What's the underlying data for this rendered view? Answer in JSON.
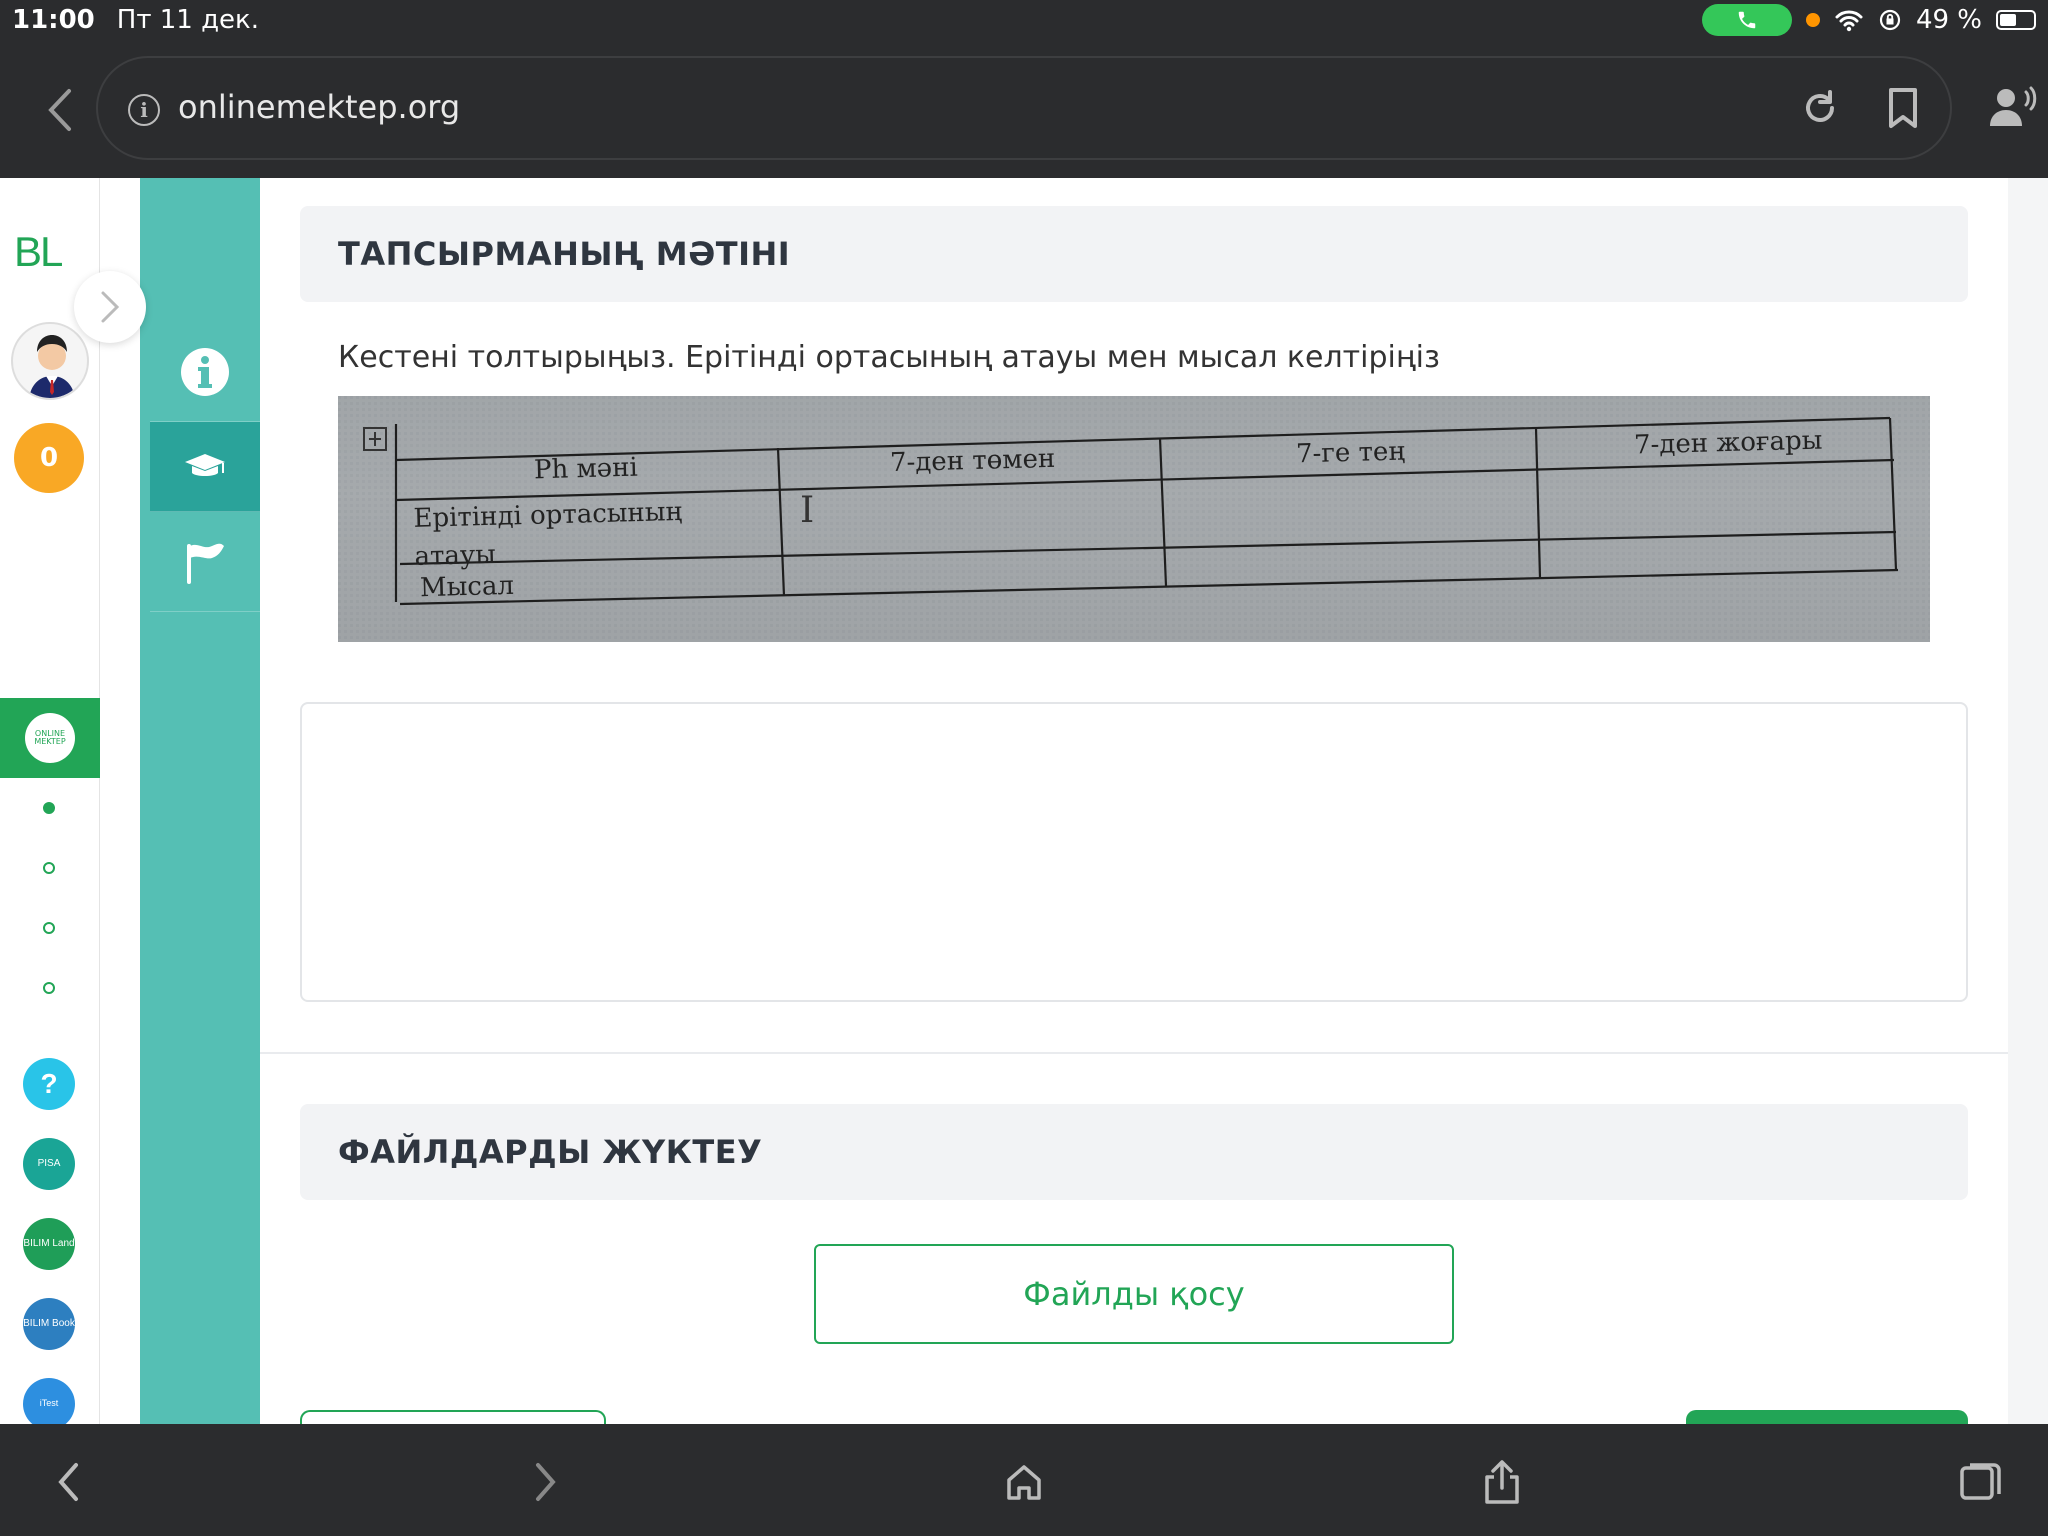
{
  "status": {
    "time": "11:00",
    "date": "Пт 11 дек.",
    "battery": "49 %"
  },
  "browser": {
    "url": "onlinemektep.org"
  },
  "sidebar": {
    "logo": "BL",
    "coins": "0",
    "om_logo": "ONLINE MEKTEP",
    "help": "?",
    "apps": [
      {
        "label": "PISA"
      },
      {
        "label": "BILIM Land"
      },
      {
        "label": "BILIM Book"
      },
      {
        "label": "iTest"
      }
    ]
  },
  "task": {
    "heading": "ТАПСЫРМАНЫҢ МӘТІНІ",
    "text": "Кестені толтырыңыз. Ерітінді ортасының атауы мен мысал келтіріңіз",
    "table": {
      "headers": [
        "Ph мәні",
        "7-ден төмен",
        "7-ге тең",
        "7-ден жоғары"
      ],
      "rows": [
        "Ерітінді ортасының атауы",
        "Мысал"
      ]
    }
  },
  "upload": {
    "heading": "ФАЙЛДАРДЫ ЖҮКТЕУ",
    "button": "Файлды қосу"
  },
  "colors": {
    "accent": "#22a556",
    "teal": "#55bfb4",
    "teal_active": "#2aa39a"
  }
}
